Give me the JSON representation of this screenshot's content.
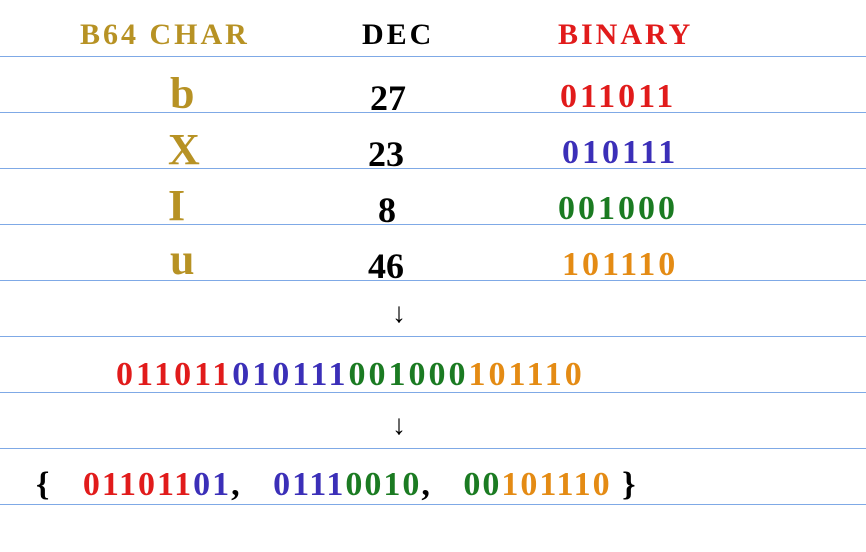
{
  "headers": {
    "char": "B64 CHAR",
    "dec": "DEC",
    "bin": "BINARY"
  },
  "rows": [
    {
      "char": "b",
      "dec": "27",
      "bin": "011011",
      "bin_color": "red"
    },
    {
      "char": "X",
      "dec": "23",
      "bin": "010111",
      "bin_color": "blue"
    },
    {
      "char": "I",
      "dec": "8",
      "bin": "001000",
      "bin_color": "green"
    },
    {
      "char": "u",
      "dec": "46",
      "bin": "101110",
      "bin_color": "orange"
    }
  ],
  "concat": {
    "segments": [
      {
        "text": "011011",
        "color": "red"
      },
      {
        "text": "010111",
        "color": "blue"
      },
      {
        "text": "001000",
        "color": "green"
      },
      {
        "text": "101110",
        "color": "orange"
      }
    ]
  },
  "bytes": {
    "open": "{",
    "close": "}",
    "sep": ",",
    "groups": [
      {
        "segments": [
          {
            "text": "011011",
            "color": "red"
          },
          {
            "text": "01",
            "color": "blue"
          }
        ]
      },
      {
        "segments": [
          {
            "text": "0111",
            "color": "blue"
          },
          {
            "text": "0010",
            "color": "green"
          }
        ]
      },
      {
        "segments": [
          {
            "text": "00",
            "color": "green"
          },
          {
            "text": "101110",
            "color": "orange"
          }
        ]
      }
    ]
  },
  "glyphs": {
    "down_arrow": "↓"
  }
}
